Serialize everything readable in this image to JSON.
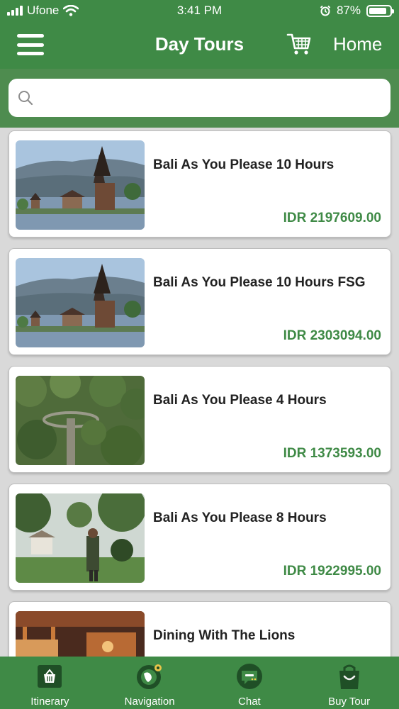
{
  "status_bar": {
    "carrier": "Ufone",
    "time": "3:41 PM",
    "battery": "87%"
  },
  "header": {
    "title": "Day Tours",
    "home_label": "Home"
  },
  "search": {
    "placeholder": ""
  },
  "tours": [
    {
      "name": "Bali As You Please 10 Hours",
      "price": "IDR 2197609.00",
      "image": "temple-lake"
    },
    {
      "name": "Bali As You Please 10 Hours FSG",
      "price": "IDR 2303094.00",
      "image": "temple-lake"
    },
    {
      "name": "Bali As You Please 4 Hours",
      "price": "IDR 1373593.00",
      "image": "forest-canopy"
    },
    {
      "name": "Bali As You Please 8 Hours",
      "price": "IDR 1922995.00",
      "image": "man-in-park"
    },
    {
      "name": "Dining With The Lions",
      "price": "",
      "image": "restaurant"
    }
  ],
  "tabs": [
    {
      "label": "Itinerary",
      "icon": "basket-icon"
    },
    {
      "label": "Navigation",
      "icon": "globe-pin-icon"
    },
    {
      "label": "Chat",
      "icon": "chat-bubble-icon"
    },
    {
      "label": "Buy Tour",
      "icon": "shopping-bag-icon"
    }
  ],
  "colors": {
    "primary": "#3f8a46",
    "price": "#3f8a46",
    "background": "#d9d9d9"
  }
}
